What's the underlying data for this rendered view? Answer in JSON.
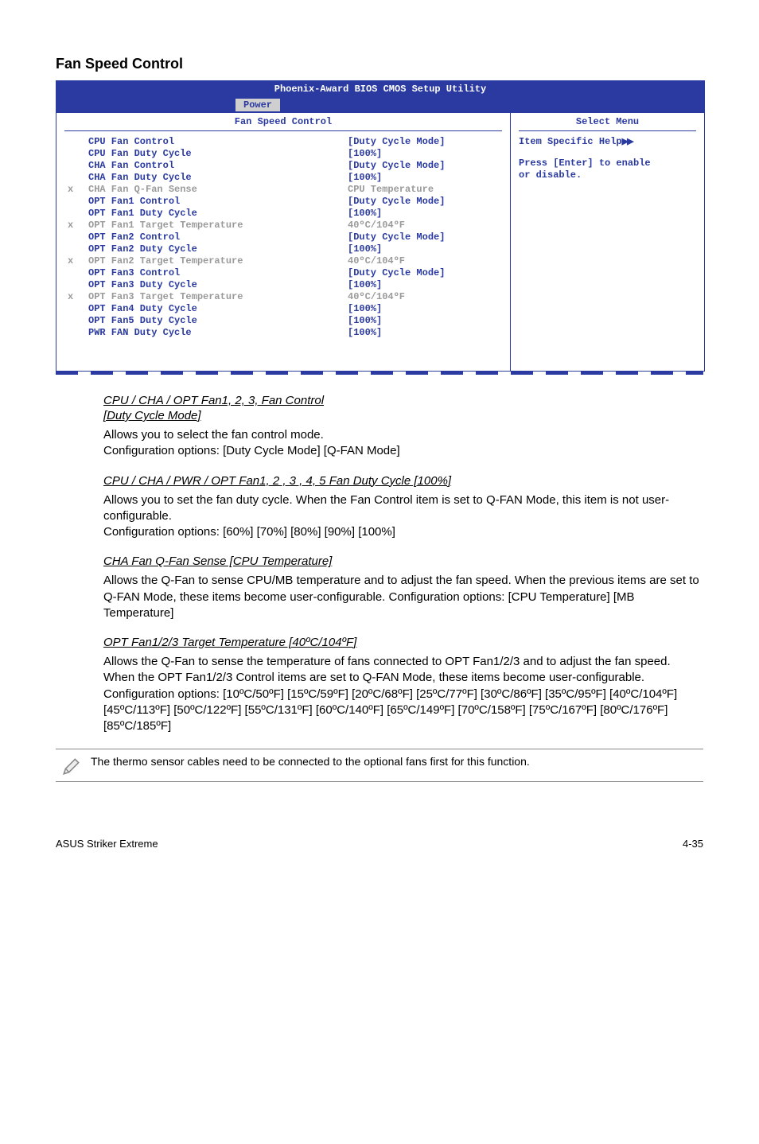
{
  "section_title": "Fan Speed Control",
  "bios": {
    "header": "Phoenix-Award BIOS CMOS Setup Utility",
    "tab": "Power",
    "left_title": "Fan Speed Control",
    "right_title": "Select Menu",
    "help_line1_prefix": "Item Specific Help",
    "help_line2": "Press [Enter] to enable",
    "help_line3": "or disable.",
    "rows": [
      {
        "x": "",
        "label": "CPU Fan Control",
        "value": "[Duty Cycle Mode]",
        "disabled": false
      },
      {
        "x": "",
        "label": "CPU Fan Duty Cycle",
        "value": "[100%]",
        "disabled": false
      },
      {
        "x": "",
        "label": "CHA Fan Control",
        "value": "[Duty Cycle Mode]",
        "disabled": false
      },
      {
        "x": "",
        "label": "CHA Fan Duty Cycle",
        "value": "[100%]",
        "disabled": false
      },
      {
        "x": "x",
        "label": "CHA Fan Q-Fan Sense",
        "value": "CPU Temperature",
        "disabled": true
      },
      {
        "x": "",
        "label": "OPT Fan1 Control",
        "value": "[Duty Cycle Mode]",
        "disabled": false
      },
      {
        "x": "",
        "label": "OPT Fan1 Duty Cycle",
        "value": "[100%]",
        "disabled": false
      },
      {
        "x": "x",
        "label": "OPT Fan1 Target Temperature",
        "value": "40ºC/104ºF",
        "disabled": true
      },
      {
        "x": "",
        "label": "OPT Fan2 Control",
        "value": "[Duty Cycle Mode]",
        "disabled": false
      },
      {
        "x": "",
        "label": "OPT Fan2 Duty Cycle",
        "value": "[100%]",
        "disabled": false
      },
      {
        "x": "x",
        "label": "OPT Fan2 Target Temperature",
        "value": "40ºC/104ºF",
        "disabled": true
      },
      {
        "x": "",
        "label": "OPT Fan3 Control",
        "value": "[Duty Cycle Mode]",
        "disabled": false
      },
      {
        "x": "",
        "label": "OPT Fan3 Duty Cycle",
        "value": "[100%]",
        "disabled": false
      },
      {
        "x": "x",
        "label": "OPT Fan3 Target Temperature",
        "value": "40ºC/104ºF",
        "disabled": true
      },
      {
        "x": "",
        "label": "OPT Fan4 Duty Cycle",
        "value": "[100%]",
        "disabled": false
      },
      {
        "x": "",
        "label": "OPT Fan5 Duty Cycle",
        "value": "[100%]",
        "disabled": false
      },
      {
        "x": "",
        "label": "PWR FAN Duty Cycle",
        "value": "[100%]",
        "disabled": false
      }
    ]
  },
  "body": {
    "h1_a": "CPU / CHA / OPT Fan1, 2, 3, Fan Control ",
    "h1_b": "[Duty Cycle Mode]",
    "p1": "Allows you to select the fan control mode.\nConfiguration options: [Duty Cycle Mode] [Q-FAN Mode]",
    "h2": "CPU / CHA / PWR / OPT Fan1, 2 , 3 , 4, 5 Fan Duty Cycle [100%]",
    "p2": "Allows you to set the fan duty cycle.  When the Fan Control item is set to Q-FAN Mode, this item is not user-configurable.\nConfiguration options: [60%] [70%] [80%] [90%] [100%]",
    "h3": "CHA Fan Q-Fan Sense [CPU Temperature]",
    "p3": "Allows the Q-Fan to sense CPU/MB temperature and to adjust the fan speed. When the previous items are set to Q-FAN Mode, these items become user-configurable. Configuration options: [CPU Temperature] [MB Temperature]",
    "h4": "OPT Fan1/2/3 Target Temperature [40ºC/104ºF] ",
    "p4": "Allows the Q-Fan to sense the temperature of fans connected to OPT Fan1/2/3 and to adjust the fan speed. When the OPT Fan1/2/3 Control items are set to Q-FAN Mode, these items become user-configurable.\nConfiguration options: [10ºC/50ºF] [15ºC/59ºF] [20ºC/68ºF] [25ºC/77ºF] [30ºC/86ºF] [35ºC/95ºF] [40ºC/104ºF] [45ºC/113ºF] [50ºC/122ºF] [55ºC/131ºF] [60ºC/140ºF] [65ºC/149ºF] [70ºC/158ºF] [75ºC/167ºF] [80ºC/176ºF] [85ºC/185ºF]",
    "note": "The thermo sensor cables need to be connected to the optional fans first for this function."
  },
  "footer": {
    "left": "ASUS Striker Extreme",
    "right": "4-35"
  }
}
